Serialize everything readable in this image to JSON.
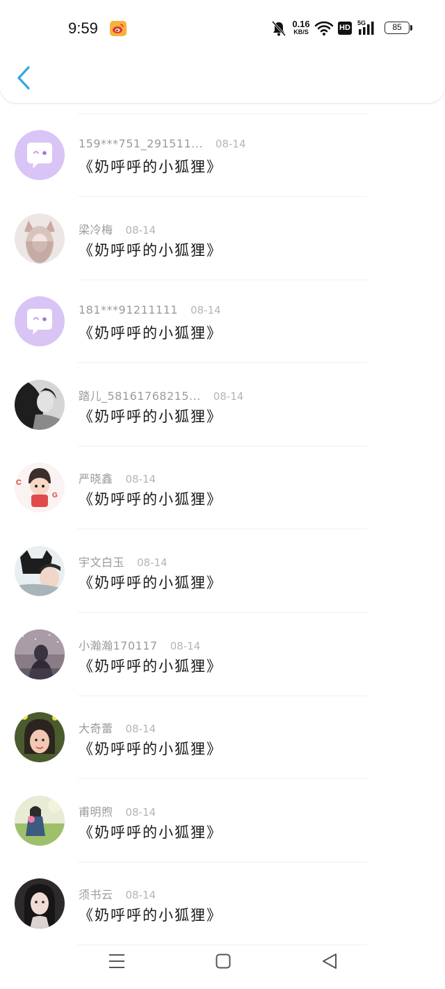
{
  "status_bar": {
    "time": "9:59",
    "net_speed": "0.16",
    "net_unit": "KB/S",
    "hd": "HD",
    "cell_type": "5G",
    "battery": "85"
  },
  "comments": [
    {
      "name": "159***751_291511...",
      "date": "08-14",
      "text": "《奶呼呼的小狐狸》",
      "avatar": "default-chat-avatar"
    },
    {
      "name": "梁冷梅",
      "date": "08-14",
      "text": "《奶呼呼的小狐狸》",
      "avatar": "fox-girl-photo"
    },
    {
      "name": "181***91211111",
      "date": "08-14",
      "text": "《奶呼呼的小狐狸》",
      "avatar": "default-chat-avatar"
    },
    {
      "name": "踏儿_58161768215...",
      "date": "08-14",
      "text": "《奶呼呼的小狐狸》",
      "avatar": "bw-portrait-photo"
    },
    {
      "name": "严晓鑫",
      "date": "08-14",
      "text": "《奶呼呼的小狐狸》",
      "avatar": "cartoon-boy-photo"
    },
    {
      "name": "宇文白玉",
      "date": "08-14",
      "text": "《奶呼呼的小狐狸》",
      "avatar": "cat-hoodie-photo"
    },
    {
      "name": "小瀚瀚170117",
      "date": "08-14",
      "text": "《奶呼呼的小狐狸》",
      "avatar": "starry-night-photo"
    },
    {
      "name": "大奇蕾",
      "date": "08-14",
      "text": "《奶呼呼的小狐狸》",
      "avatar": "child-selfie-photo"
    },
    {
      "name": "甫明煦",
      "date": "08-14",
      "text": "《奶呼呼的小狐狸》",
      "avatar": "outdoor-girl-photo"
    },
    {
      "name": "须书云",
      "date": "08-14",
      "text": "《奶呼呼的小狐狸》",
      "avatar": "dark-hair-girl-photo"
    }
  ],
  "colors": {
    "accent": "#2ea6e8",
    "default_avatar_bg": "#d9c4f6",
    "name_text": "#9a9a9a",
    "date_text": "#b4b4b4"
  }
}
